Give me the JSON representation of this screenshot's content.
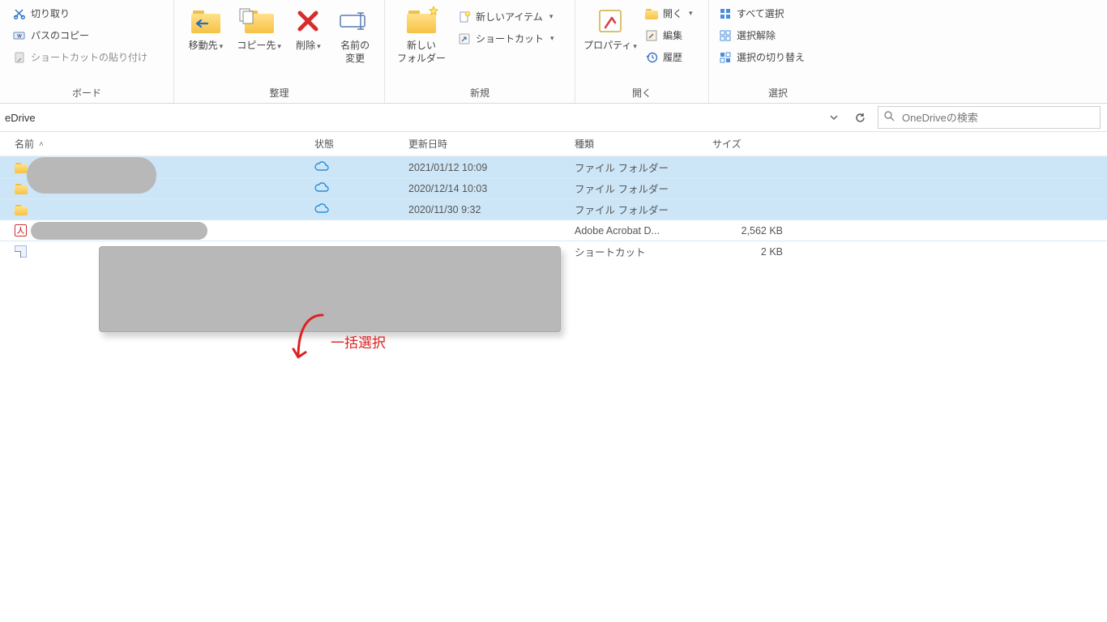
{
  "ribbon": {
    "clipboard": {
      "title": "ボード",
      "cut": "切り取り",
      "copy_path": "パスのコピー",
      "paste_shortcut": "ショートカットの貼り付け"
    },
    "organize": {
      "title": "整理",
      "move_to": "移動先",
      "copy_to": "コピー先",
      "delete": "削除",
      "rename": "名前の\n変更"
    },
    "new": {
      "title": "新規",
      "new_folder": "新しい\nフォルダー",
      "new_item": "新しいアイテム",
      "shortcut": "ショートカット"
    },
    "open": {
      "title": "開く",
      "properties": "プロパティ",
      "open": "開く",
      "edit": "編集",
      "history": "履歴"
    },
    "select": {
      "title": "選択",
      "select_all": "すべて選択",
      "select_none": "選択解除",
      "invert_selection": "選択の切り替え"
    }
  },
  "path": {
    "current": "eDrive",
    "search_placeholder": "OneDriveの検索"
  },
  "columns": {
    "name": "名前",
    "state": "状態",
    "date": "更新日時",
    "type": "種類",
    "size": "サイズ"
  },
  "rows": [
    {
      "selected": true,
      "icon": "folder",
      "date": "2021/01/12 10:09",
      "type": "ファイル フォルダー",
      "size": ""
    },
    {
      "selected": true,
      "icon": "folder",
      "date": "2020/12/14 10:03",
      "type": "ファイル フォルダー",
      "size": ""
    },
    {
      "selected": true,
      "icon": "folder",
      "date": "2020/11/30 9:32",
      "type": "ファイル フォルダー",
      "size": ""
    },
    {
      "selected": false,
      "icon": "pdf",
      "date": "",
      "type": "Adobe Acrobat D...",
      "size": "2,562 KB"
    },
    {
      "selected": false,
      "icon": "lnk",
      "date": "",
      "type": "ショートカット",
      "size": "2 KB"
    }
  ],
  "annotation": "一括選択"
}
